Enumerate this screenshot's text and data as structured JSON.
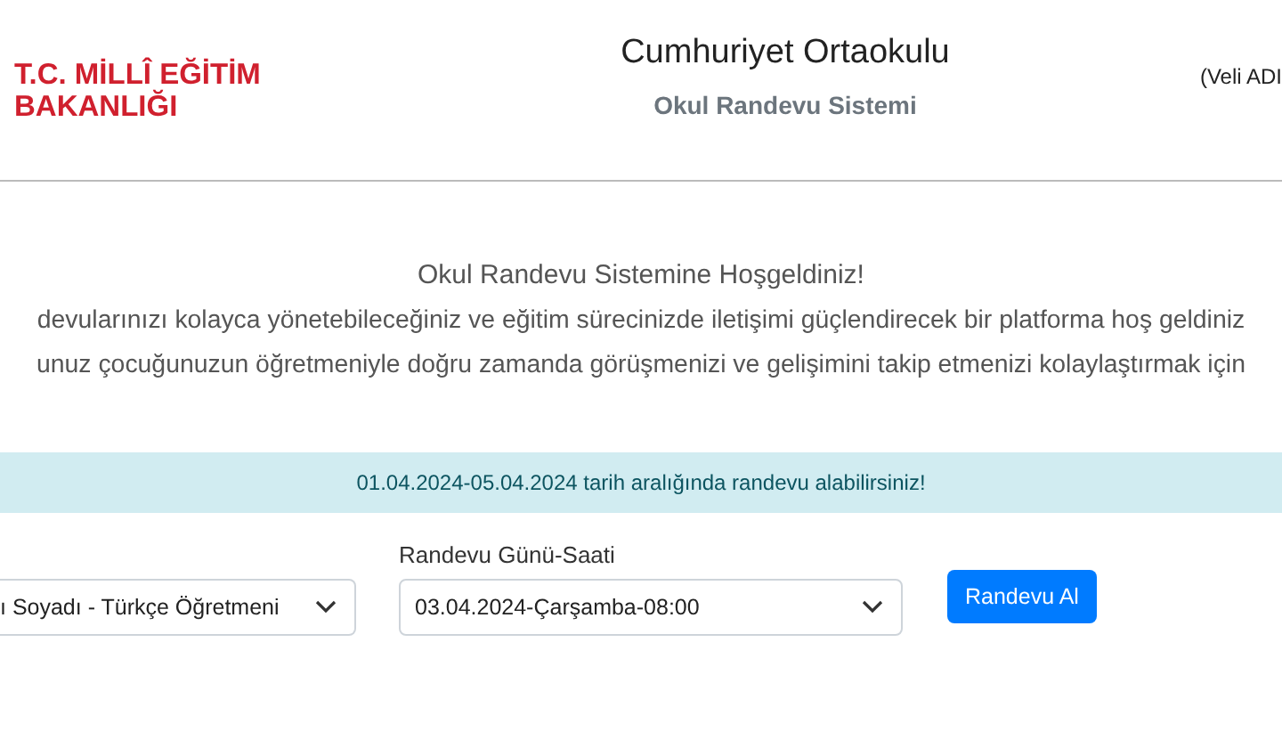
{
  "header": {
    "logo_lines": [
      "T.C. MİLLÎ EĞİTİM",
      "BAKANLIĞI"
    ],
    "title": "Cumhuriyet Ortaokulu",
    "subtitle": "Okul Randevu Sistemi",
    "user": "(Veli ADI"
  },
  "welcome": {
    "heading": "Okul Randevu Sistemine Hoşgeldiniz!",
    "lines": [
      "devularınızı kolayca yönetebileceğiniz ve eğitim sürecinizde iletişimi güçlendirecek bir platforma hoş geldiniz",
      "unuz çocuğunuzun öğretmeniyle doğru zamanda görüşmenizi ve gelişimini takip etmenizi kolaylaştırmak için"
    ]
  },
  "notice": "01.04.2024-05.04.2024 tarih aralığında randevu alabilirsiniz!",
  "form": {
    "teacher_value": "ı Soyadı  -  Türkçe Öğretmeni",
    "time_label": "Randevu Günü-Saati",
    "time_value": "03.04.2024-Çarşamba-08:00",
    "button": "Randevu Al"
  }
}
